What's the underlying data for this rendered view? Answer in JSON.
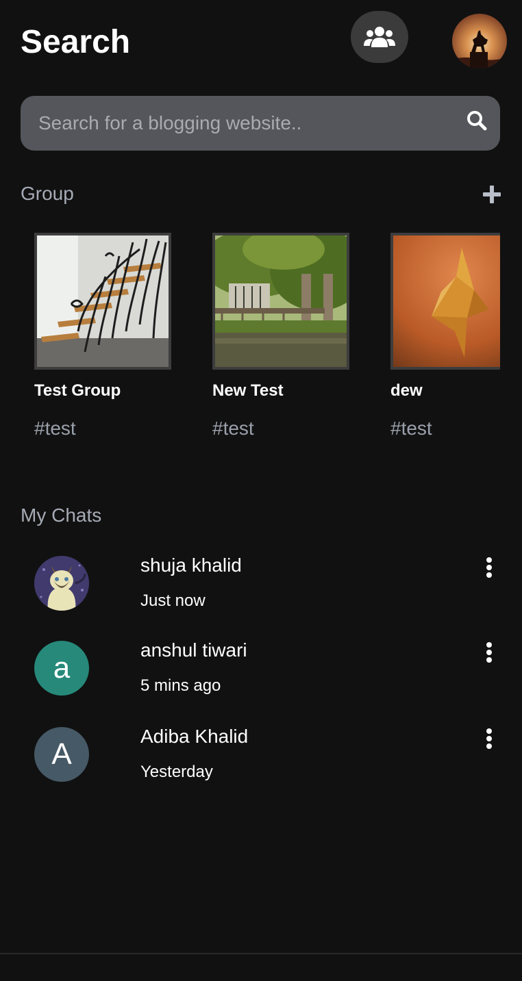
{
  "header": {
    "title": "Search",
    "groups_icon": "users-icon",
    "profile_avatar": "horse-statue-sunset-avatar"
  },
  "search": {
    "placeholder": "Search for a blogging website..",
    "value": "",
    "icon": "search-icon"
  },
  "groups_section": {
    "label": "Group",
    "add_icon": "plus-icon",
    "items": [
      {
        "name": "Test Group",
        "tag": "#test",
        "image": "staircase-photo"
      },
      {
        "name": "New Test",
        "tag": "#test",
        "image": "pond-bridge-photo"
      },
      {
        "name": "dew",
        "tag": "#test",
        "image": "origami-crane-photo"
      }
    ]
  },
  "chats_section": {
    "label": "My Chats",
    "items": [
      {
        "name": "shuja khalid",
        "time": "Just now",
        "avatar": "cat-illustration",
        "initial": ""
      },
      {
        "name": "anshul tiwari",
        "time": "5 mins ago",
        "avatar": "initial",
        "initial": "a",
        "color": "#26897a"
      },
      {
        "name": "Adiba Khalid",
        "time": "Yesterday",
        "avatar": "initial",
        "initial": "A",
        "color": "#465966"
      }
    ],
    "menu_icon": "more-vertical-icon"
  },
  "colors": {
    "background": "#111111",
    "search_bg": "#55565b",
    "muted_text": "#a6abb5"
  }
}
